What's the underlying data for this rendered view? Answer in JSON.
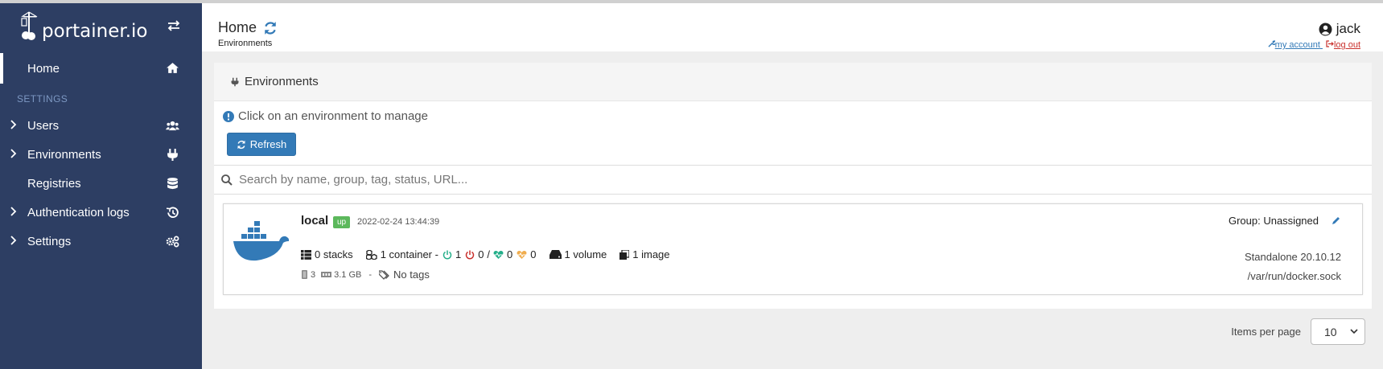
{
  "brand": {
    "logo_text": "portainer.io"
  },
  "sidebar": {
    "home_label": "Home",
    "section_label": "SETTINGS",
    "items": [
      {
        "label": "Users",
        "icon": "users-icon"
      },
      {
        "label": "Environments",
        "icon": "plug-icon"
      },
      {
        "label": "Registries",
        "icon": "database-icon"
      },
      {
        "label": "Authentication logs",
        "icon": "history-icon"
      },
      {
        "label": "Settings",
        "icon": "cogs-icon"
      }
    ]
  },
  "header": {
    "title": "Home",
    "breadcrumb": "Environments",
    "username": "jack",
    "my_account": "my account",
    "log_out": "log out"
  },
  "panel": {
    "title": "Environments",
    "info_text": "Click on an environment to manage",
    "refresh_label": "Refresh",
    "search_placeholder": "Search by name, group, tag, status, URL..."
  },
  "environment": {
    "name": "local",
    "status": "up",
    "timestamp": "2022-02-24 13:44:39",
    "group": "Group: Unassigned",
    "stacks": "0 stacks",
    "containers": "1 container -",
    "running": "1",
    "stopped": "0",
    "separator": "/",
    "healthy": "0",
    "unhealthy": "0",
    "volumes": "1 volume",
    "images": "1 image",
    "cpu": "3",
    "memory": "3.1 GB",
    "dash": "-",
    "tags": "No tags",
    "version": "Standalone 20.10.12",
    "url": "/var/run/docker.sock"
  },
  "pagination": {
    "label": "Items per page",
    "value": "10"
  },
  "colors": {
    "sidebar_bg": "#2d3e63",
    "primary": "#337ab7",
    "success": "#5cb85c",
    "danger": "#c9302c",
    "warning": "#f0ad4e"
  }
}
